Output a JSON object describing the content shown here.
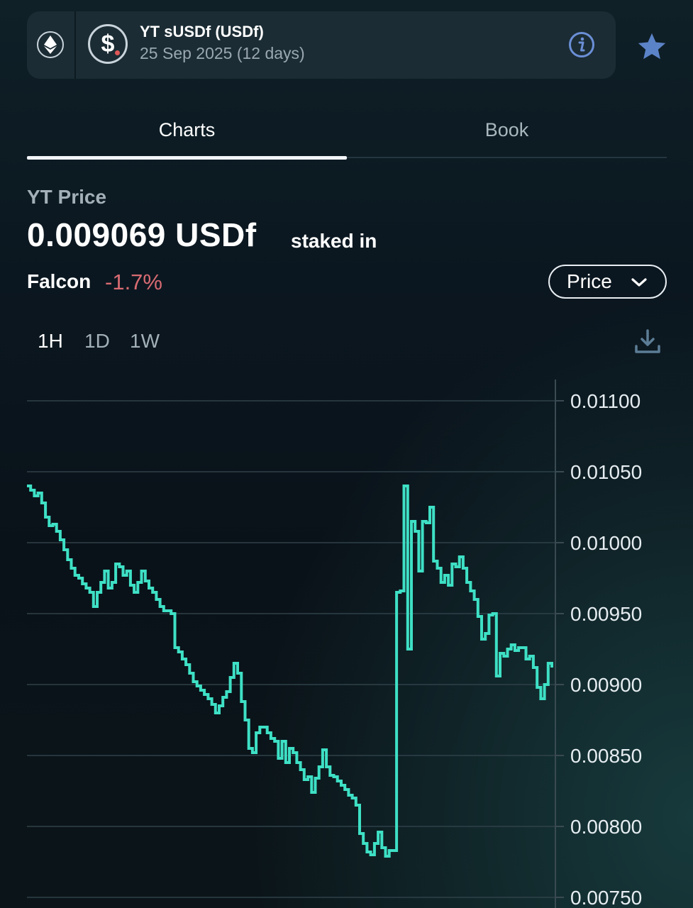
{
  "header": {
    "title": "YT sUSDf (USDf)",
    "subtitle": "25 Sep 2025 (12 days)"
  },
  "tabs": [
    {
      "label": "Charts",
      "active": true
    },
    {
      "label": "Book",
      "active": false
    }
  ],
  "summary": {
    "label": "YT Price",
    "value": "0.009069 USDf",
    "suffix": "staked in",
    "protocol": "Falcon",
    "change": "-1.7%"
  },
  "price_select": {
    "label": "Price"
  },
  "ranges": [
    {
      "label": "1H",
      "active": true
    },
    {
      "label": "1D",
      "active": false
    },
    {
      "label": "1W",
      "active": false
    }
  ],
  "colors": {
    "accent": "#3ee0c5",
    "negative": "#d86b72"
  },
  "chart_data": {
    "type": "line",
    "ylim": [
      0.0075,
      0.0112
    ],
    "y_ticks": [
      "0.01100",
      "0.01050",
      "0.01000",
      "0.00950",
      "0.00900",
      "0.00850",
      "0.00800",
      "0.00750"
    ],
    "y_tick_values": [
      0.011,
      0.0105,
      0.01,
      0.0095,
      0.009,
      0.0085,
      0.008,
      0.0075
    ],
    "grid": true,
    "series": [
      {
        "values": [
          0.0104,
          0.01037,
          0.01033,
          0.01035,
          0.01028,
          0.01018,
          0.01012,
          0.01013,
          0.01008,
          0.01002,
          0.00995,
          0.00988,
          0.00982,
          0.00977,
          0.00975,
          0.00971,
          0.00968,
          0.00965,
          0.00955,
          0.00965,
          0.00972,
          0.0098,
          0.00968,
          0.00972,
          0.00985,
          0.00983,
          0.00977,
          0.0098,
          0.0097,
          0.00965,
          0.00972,
          0.0098,
          0.00973,
          0.00968,
          0.00965,
          0.0096,
          0.00955,
          0.00952,
          0.00952,
          0.0095,
          0.00926,
          0.00923,
          0.00918,
          0.00914,
          0.00908,
          0.00902,
          0.00899,
          0.00896,
          0.00893,
          0.0089,
          0.00886,
          0.0088,
          0.00885,
          0.00891,
          0.00895,
          0.00905,
          0.00915,
          0.00908,
          0.00888,
          0.00875,
          0.00855,
          0.00852,
          0.00866,
          0.0087,
          0.0087,
          0.00866,
          0.00862,
          0.0086,
          0.00848,
          0.0086,
          0.00845,
          0.00855,
          0.00852,
          0.00845,
          0.0084,
          0.00833,
          0.00835,
          0.00824,
          0.00834,
          0.00842,
          0.00854,
          0.00842,
          0.00836,
          0.00835,
          0.00832,
          0.00829,
          0.00826,
          0.00822,
          0.0082,
          0.00815,
          0.00795,
          0.00788,
          0.00782,
          0.0078,
          0.00788,
          0.00796,
          0.00785,
          0.00779,
          0.00783,
          0.00783,
          0.00965,
          0.00966,
          0.0104,
          0.00925,
          0.01015,
          0.01008,
          0.0098,
          0.01015,
          0.01014,
          0.01025,
          0.00987,
          0.00982,
          0.00972,
          0.00977,
          0.0097,
          0.00985,
          0.00983,
          0.0099,
          0.00982,
          0.00972,
          0.00966,
          0.0096,
          0.00948,
          0.00932,
          0.00936,
          0.00949,
          0.0095,
          0.00906,
          0.00922,
          0.0092,
          0.00925,
          0.00928,
          0.00924,
          0.00926,
          0.00926,
          0.00918,
          0.0092,
          0.00912,
          0.00898,
          0.0089,
          0.009,
          0.00915,
          0.00912
        ]
      }
    ]
  }
}
